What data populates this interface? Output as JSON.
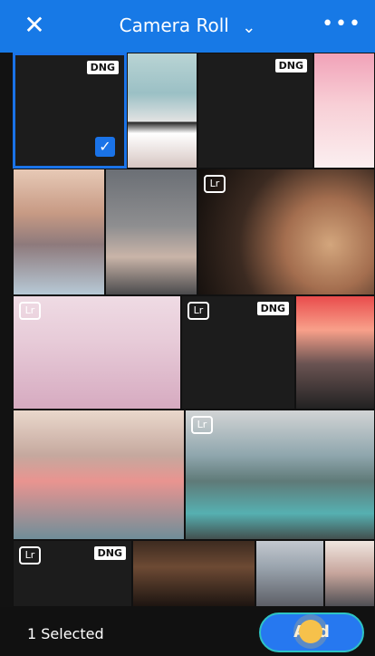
{
  "header": {
    "title": "Camera Roll",
    "close_icon": "close-icon",
    "dropdown_icon": "chevron-down-icon",
    "more_icon": "more-icon"
  },
  "grid": {
    "row1": [
      {
        "type": "dark",
        "badge": "DNG",
        "selected": true
      },
      {
        "type": "photo",
        "name": "laundry"
      },
      {
        "type": "dark",
        "badge": "DNG"
      },
      {
        "type": "photo",
        "name": "pink-blonde"
      }
    ],
    "row2": [
      {
        "type": "photo",
        "name": "diner"
      },
      {
        "type": "photo",
        "name": "hall"
      },
      {
        "type": "photo",
        "name": "face",
        "lr": "Lr"
      }
    ],
    "row3": [
      {
        "type": "photo",
        "name": "wall",
        "lr": "Lr"
      },
      {
        "type": "dark",
        "lr": "Lr",
        "badge": "DNG"
      },
      {
        "type": "photo",
        "name": "store"
      }
    ],
    "row4": [
      {
        "type": "photo",
        "name": "smoke"
      },
      {
        "type": "photo",
        "name": "lake",
        "lr": "Lr"
      }
    ],
    "row5": [
      {
        "type": "dark",
        "lr": "Lr",
        "badge": "DNG"
      },
      {
        "type": "photo",
        "name": "wood"
      },
      {
        "type": "photo",
        "name": "city1"
      },
      {
        "type": "photo",
        "name": "city2"
      }
    ]
  },
  "footer": {
    "selected_text": "1 Selected",
    "add_label": "Add"
  },
  "colors": {
    "primary": "#1779e6",
    "accent": "#1a73e8",
    "button": "#2678f0",
    "highlight": "#2ec4c4",
    "pointer": "#f6c14b"
  }
}
